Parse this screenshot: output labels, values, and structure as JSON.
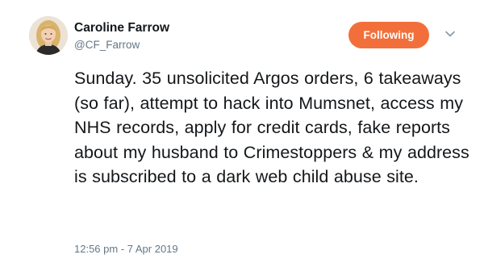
{
  "tweet": {
    "author": {
      "display_name": "Caroline Farrow",
      "handle": "@CF_Farrow",
      "avatar_icon": "profile-photo"
    },
    "follow_button": {
      "label": "Following",
      "color": "#f26f3b"
    },
    "menu_icon": "chevron-down-icon",
    "text": "Sunday. 35 unsolicited Argos orders, 6 takeaways (so far), attempt to hack into Mumsnet, access my NHS records, apply for credit cards, fake reports about my husband to Crimestoppers & my address is subscribed to a dark web child abuse site.",
    "timestamp": "12:56 pm - 7 Apr 2019"
  }
}
